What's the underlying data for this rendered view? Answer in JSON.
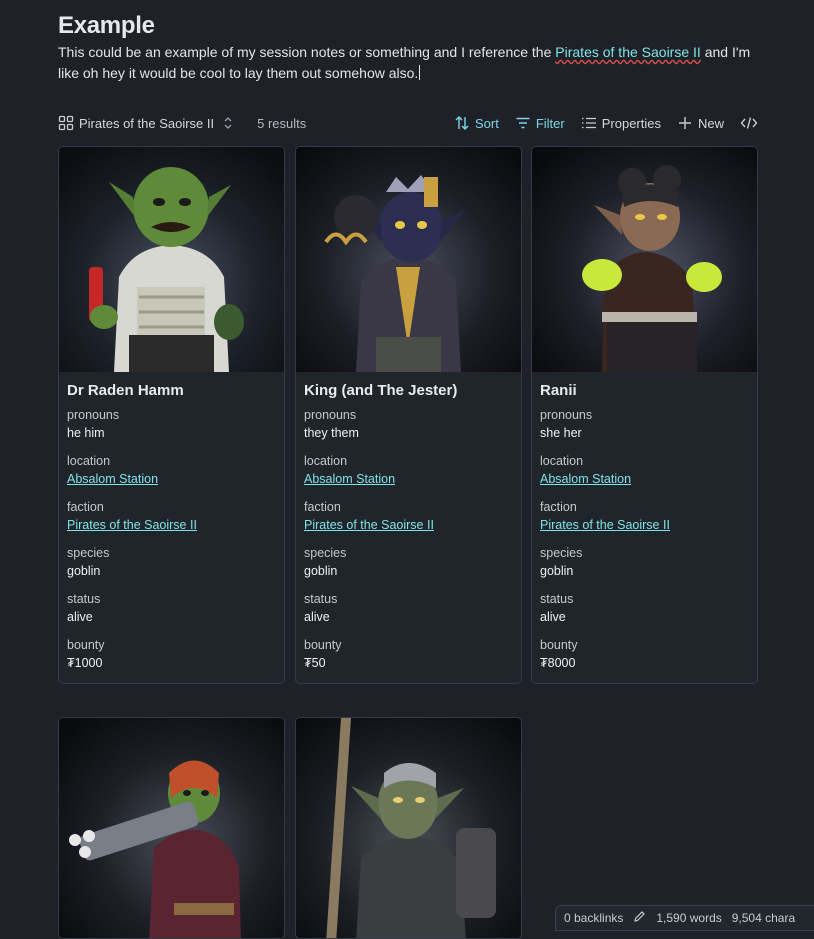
{
  "page": {
    "title": "Example",
    "note_before": "This could be an example of my session notes or something and I reference the ",
    "note_link": "Pirates of the Saoirse II",
    "note_after": " and I'm like oh hey it would be cool to lay them out somehow also."
  },
  "toolbar": {
    "view_name": "Pirates of the Saoirse II",
    "results": "5 results",
    "sort_label": "Sort",
    "filter_label": "Filter",
    "properties_label": "Properties",
    "new_label": "New",
    "colors": {
      "accent": "#7fd6e6"
    }
  },
  "labels": {
    "pronouns": "pronouns",
    "location": "location",
    "faction": "faction",
    "species": "species",
    "status": "status",
    "bounty": "bounty"
  },
  "cards": [
    {
      "name": "Dr Raden Hamm",
      "pronouns": "he him",
      "location": "Absalom Station",
      "faction": "Pirates of the Saoirse II",
      "species": "goblin",
      "status": "alive",
      "bounty": "₮1000",
      "image_colors": {
        "skin": "#5e8a3a",
        "outfit": "#d8d8d2",
        "accent": "#c62828"
      }
    },
    {
      "name": "King (and The Jester)",
      "pronouns": "they them",
      "location": "Absalom Station",
      "faction": "Pirates of the Saoirse II",
      "species": "goblin",
      "status": "alive",
      "bounty": "₮50",
      "image_colors": {
        "skin": "#2c2f52",
        "outfit": "#3a3846",
        "accent": "#c8a040"
      }
    },
    {
      "name": "Ranii",
      "pronouns": "she her",
      "location": "Absalom Station",
      "faction": "Pirates of the Saoirse II",
      "species": "goblin",
      "status": "alive",
      "bounty": "₮8000",
      "image_colors": {
        "skin": "#8a6a52",
        "outfit": "#3a2620",
        "accent": "#c8e83c"
      }
    },
    {
      "image_colors": {
        "skin": "#5e8a3a",
        "outfit": "#5a2430",
        "accent": "#c0502c"
      }
    },
    {
      "image_colors": {
        "skin": "#6a7858",
        "outfit": "#3a3e40",
        "accent": "#8a7a60"
      }
    }
  ],
  "statusbar": {
    "backlinks": "0 backlinks",
    "words": "1,590 words",
    "characters": "9,504 chara"
  }
}
